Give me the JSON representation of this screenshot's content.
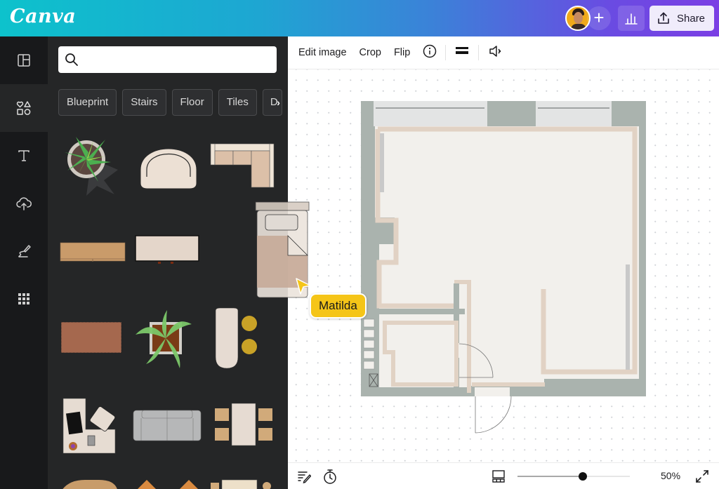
{
  "app": {
    "logo": "Canva"
  },
  "header": {
    "collaborator_avatar": "avatar",
    "add_collaborator_icon": "plus-icon",
    "insights_icon": "bar-chart-icon",
    "share_label": "Share",
    "share_icon": "upload-icon"
  },
  "rail": {
    "items": [
      {
        "name": "design",
        "icon": "layout-icon"
      },
      {
        "name": "elements",
        "icon": "shapes-icon",
        "active": true
      },
      {
        "name": "text",
        "icon": "text-icon"
      },
      {
        "name": "uploads",
        "icon": "cloud-upload-icon"
      },
      {
        "name": "draw",
        "icon": "draw-icon"
      },
      {
        "name": "apps",
        "icon": "grid-icon"
      }
    ]
  },
  "panel": {
    "search": {
      "placeholder": "",
      "value": ""
    },
    "chips": [
      "Blueprint",
      "Stairs",
      "Floor",
      "Tiles",
      "D"
    ],
    "elements": [
      "potted-plant",
      "armchair",
      "sectional-sofa",
      "wooden-bench",
      "coffee-table",
      "single-bed",
      "terracotta-rug",
      "square-planter",
      "bar-counter-with-stools",
      "corner-desk-with-chair",
      "gray-sofa",
      "dining-table-with-chairs",
      "round-table",
      "lounge-chairs",
      "bed-with-nightstands"
    ]
  },
  "toolbar": {
    "edit_image": "Edit image",
    "crop": "Crop",
    "flip": "Flip",
    "info_icon": "info-icon",
    "position_icon": "lines-icon",
    "animate_icon": "speaker-icon"
  },
  "canvas": {
    "design": "floor-plan",
    "collaborator_cursor": {
      "name": "Matilda",
      "color": "#F5C518"
    }
  },
  "footer": {
    "notes_icon": "notes-icon",
    "timer_icon": "timer-icon",
    "pages_icon": "pages-icon",
    "zoom_percent": 50,
    "zoom_label": "50%",
    "fullscreen_icon": "expand-icon"
  }
}
